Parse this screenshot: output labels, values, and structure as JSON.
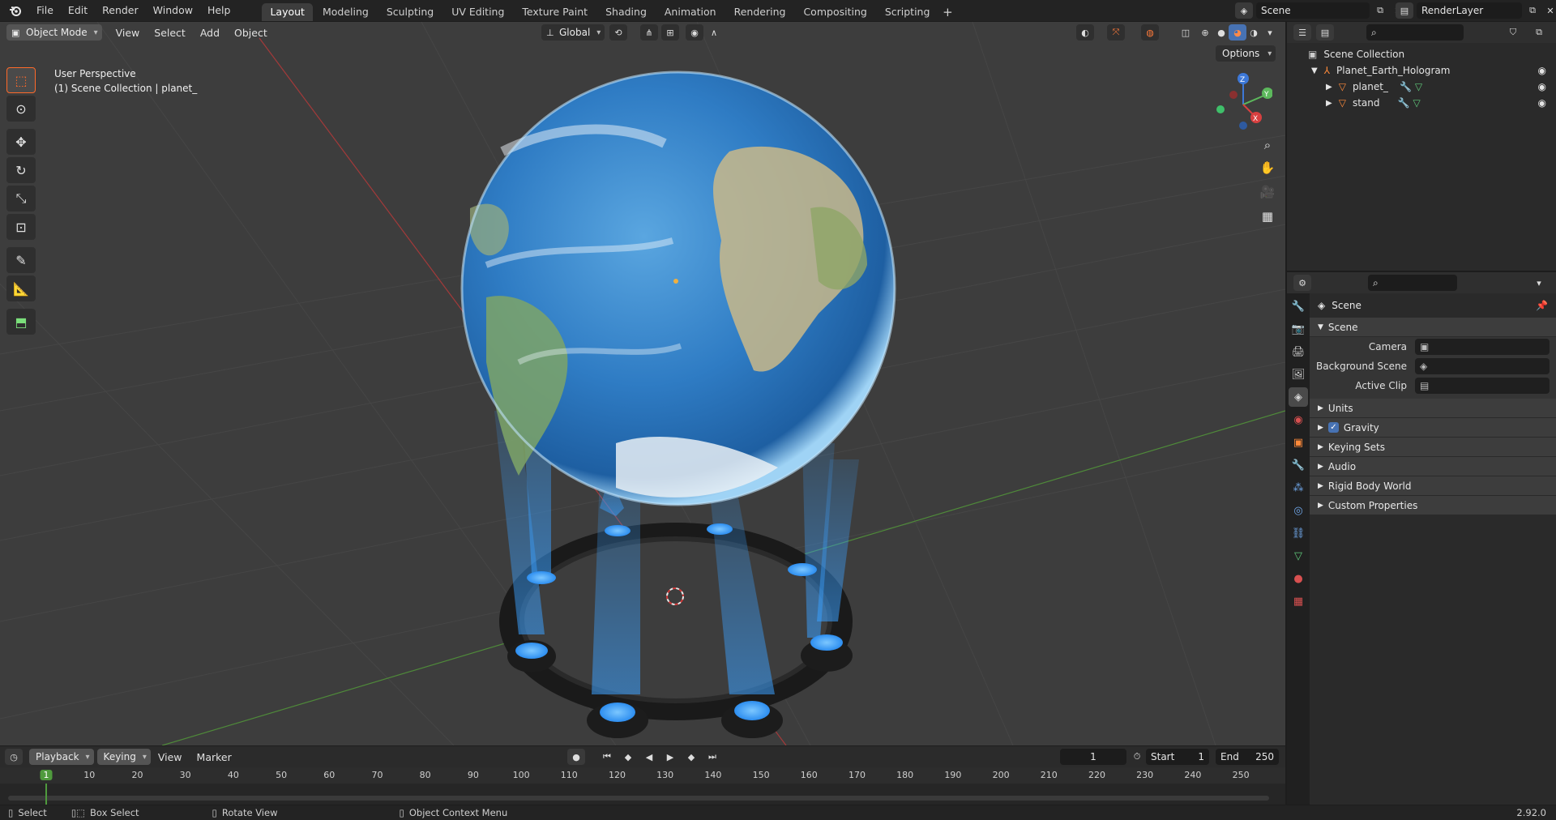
{
  "topbar": {
    "menus": [
      "File",
      "Edit",
      "Render",
      "Window",
      "Help"
    ],
    "workspace_tabs": [
      "Layout",
      "Modeling",
      "Sculpting",
      "UV Editing",
      "Texture Paint",
      "Shading",
      "Animation",
      "Rendering",
      "Compositing",
      "Scripting"
    ],
    "active_tab": "Layout",
    "add_tab": "+",
    "scene_name": "Scene",
    "render_layer": "RenderLayer"
  },
  "viewport": {
    "mode": "Object Mode",
    "menus": [
      "View",
      "Select",
      "Add",
      "Object"
    ],
    "orientation": "Global",
    "options_label": "Options",
    "perspective_label": "User Perspective",
    "collection_label": "(1) Scene Collection | planet_",
    "gizmo_axes": [
      "Z",
      "Y",
      "X"
    ]
  },
  "outliner": {
    "root": "Scene Collection",
    "collection": "Planet_Earth_Hologram",
    "objects": [
      "planet_",
      "stand"
    ]
  },
  "properties": {
    "title": "Scene",
    "section": "Scene",
    "fields": [
      {
        "label": "Camera"
      },
      {
        "label": "Background Scene"
      },
      {
        "label": "Active Clip"
      }
    ],
    "subsections": [
      "Units",
      "Gravity",
      "Keying Sets",
      "Audio",
      "Rigid Body World",
      "Custom Properties"
    ],
    "gravity_checked": true
  },
  "timeline": {
    "menus": [
      "Playback",
      "Keying",
      "View",
      "Marker"
    ],
    "current_frame": "1",
    "start_label": "Start",
    "start": "1",
    "end_label": "End",
    "end": "250",
    "ticks": [
      "1",
      "10",
      "20",
      "30",
      "40",
      "50",
      "60",
      "70",
      "80",
      "90",
      "100",
      "110",
      "120",
      "130",
      "140",
      "150",
      "160",
      "170",
      "180",
      "190",
      "200",
      "210",
      "220",
      "230",
      "240",
      "250"
    ]
  },
  "statusbar": {
    "items": [
      "Select",
      "Box Select",
      "Rotate View",
      "Object Context Menu"
    ],
    "version": "2.92.0"
  },
  "colors": {
    "accent": "#4772b3",
    "active_tool": "#ff6a2a",
    "hologram": "#3aa0ff",
    "current_frame": "#4f9a3d"
  }
}
